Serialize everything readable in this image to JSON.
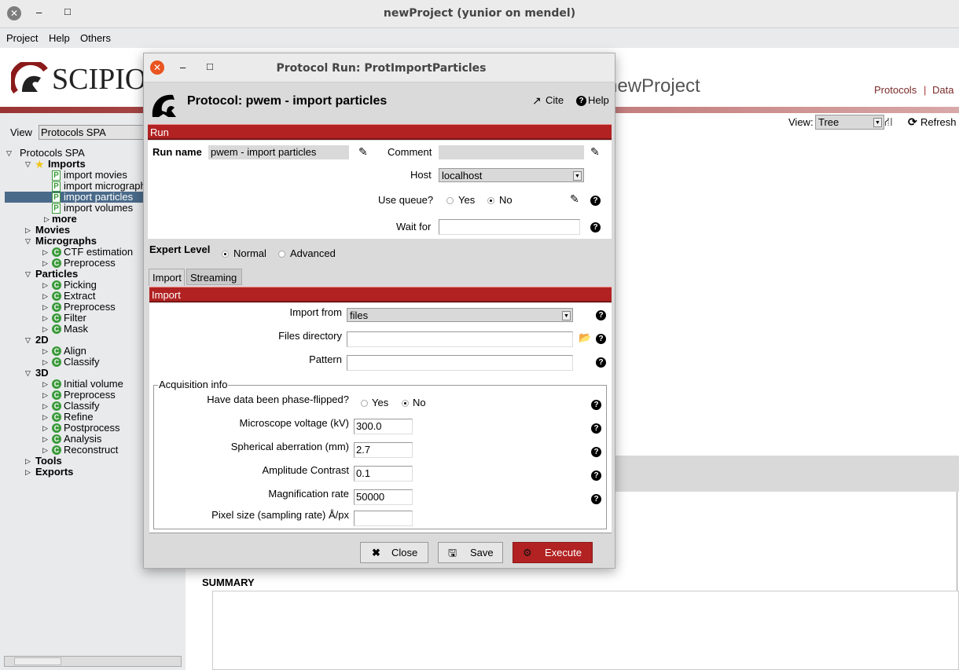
{
  "window": {
    "title": "newProject (yunior on mendel)",
    "close": "✕",
    "minimize": "–",
    "maximize": "□"
  },
  "menu": [
    "Project",
    "Help",
    "Others"
  ],
  "header": {
    "logo_text": "SCIPIO",
    "project_name": "newProject",
    "nav_protocols": "Protocols",
    "nav_sep": "|",
    "nav_data": "Data"
  },
  "sidebar": {
    "view_label": "View",
    "view_value": "Protocols SPA",
    "tree": [
      {
        "label": "Protocols SPA",
        "level": 0,
        "open": true
      },
      {
        "label": "Imports",
        "level": 1,
        "open": true,
        "bold": true,
        "icon": "star"
      },
      {
        "label": "import movies",
        "level": 2,
        "icon": "P"
      },
      {
        "label": "import micrographs",
        "level": 2,
        "icon": "P"
      },
      {
        "label": "import particles",
        "level": 2,
        "icon": "P",
        "selected": true
      },
      {
        "label": "import volumes",
        "level": 2,
        "icon": "P"
      },
      {
        "label": "more",
        "level": 1.5,
        "bold": true
      },
      {
        "label": "Movies",
        "level": 1,
        "bold": true
      },
      {
        "label": "Micrographs",
        "level": 1,
        "open": true,
        "bold": true
      },
      {
        "label": "CTF estimation",
        "level": 2,
        "icon": "C",
        "expand": true
      },
      {
        "label": "Preprocess",
        "level": 2,
        "icon": "C",
        "expand": true
      },
      {
        "label": "Particles",
        "level": 1,
        "open": true,
        "bold": true
      },
      {
        "label": "Picking",
        "level": 2,
        "icon": "C",
        "expand": true
      },
      {
        "label": "Extract",
        "level": 2,
        "icon": "C",
        "expand": true
      },
      {
        "label": "Preprocess",
        "level": 2,
        "icon": "C",
        "expand": true
      },
      {
        "label": "Filter",
        "level": 2,
        "icon": "C",
        "expand": true
      },
      {
        "label": "Mask",
        "level": 2,
        "icon": "C",
        "expand": true
      },
      {
        "label": "2D",
        "level": 1,
        "open": true,
        "bold": true
      },
      {
        "label": "Align",
        "level": 2,
        "icon": "C",
        "expand": true
      },
      {
        "label": "Classify",
        "level": 2,
        "icon": "C",
        "expand": true
      },
      {
        "label": "3D",
        "level": 1,
        "open": true,
        "bold": true
      },
      {
        "label": "Initial volume",
        "level": 2,
        "icon": "C",
        "expand": true
      },
      {
        "label": "Preprocess",
        "level": 2,
        "icon": "C",
        "expand": true
      },
      {
        "label": "Classify",
        "level": 2,
        "icon": "C",
        "expand": true
      },
      {
        "label": "Refine",
        "level": 2,
        "icon": "C",
        "expand": true
      },
      {
        "label": "Postprocess",
        "level": 2,
        "icon": "C",
        "expand": true
      },
      {
        "label": "Analysis",
        "level": 2,
        "icon": "C",
        "expand": true
      },
      {
        "label": "Reconstruct",
        "level": 2,
        "icon": "C",
        "expand": true
      },
      {
        "label": "Tools",
        "level": 1,
        "bold": true
      },
      {
        "label": "Exports",
        "level": 1,
        "bold": true
      }
    ]
  },
  "toolbar": {
    "view_label": "View:",
    "view_value": "Tree",
    "refresh": "Refresh"
  },
  "main": {
    "summary": "SUMMARY"
  },
  "dialog": {
    "title": "Protocol Run: ProtImportParticles",
    "protocol_heading": "Protocol: pwem - import particles",
    "cite": "Cite",
    "help": "Help",
    "run_section": "Run",
    "run_name_label": "Run name",
    "run_name_value": "pwem - import particles",
    "comment_label": "Comment",
    "comment_value": "",
    "host_label": "Host",
    "host_value": "localhost",
    "queue_label": "Use queue?",
    "queue_yes": "Yes",
    "queue_no": "No",
    "queue_selected": "No",
    "wait_label": "Wait for",
    "wait_value": "",
    "expert_label": "Expert Level",
    "expert_normal": "Normal",
    "expert_advanced": "Advanced",
    "expert_selected": "Normal",
    "tabs": [
      "Import",
      "Streaming"
    ],
    "active_tab": "Import",
    "import_section": "Import",
    "import_from_label": "Import from",
    "import_from_value": "files",
    "files_dir_label": "Files directory",
    "files_dir_value": "",
    "pattern_label": "Pattern",
    "pattern_value": "",
    "acq_title": "Acquisition info",
    "phase_label": "Have data been phase-flipped?",
    "phase_yes": "Yes",
    "phase_no": "No",
    "phase_selected": "No",
    "voltage_label": "Microscope voltage (kV)",
    "voltage_value": "300.0",
    "cs_label": "Spherical aberration (mm)",
    "cs_value": "2.7",
    "ac_label": "Amplitude Contrast",
    "ac_value": "0.1",
    "mag_label": "Magnification rate",
    "mag_value": "50000",
    "pix_label": "Pixel size (sampling rate) Å/px",
    "pix_value": "",
    "close": "Close",
    "save": "Save",
    "execute": "Execute",
    "execute_color": "#b22222"
  }
}
